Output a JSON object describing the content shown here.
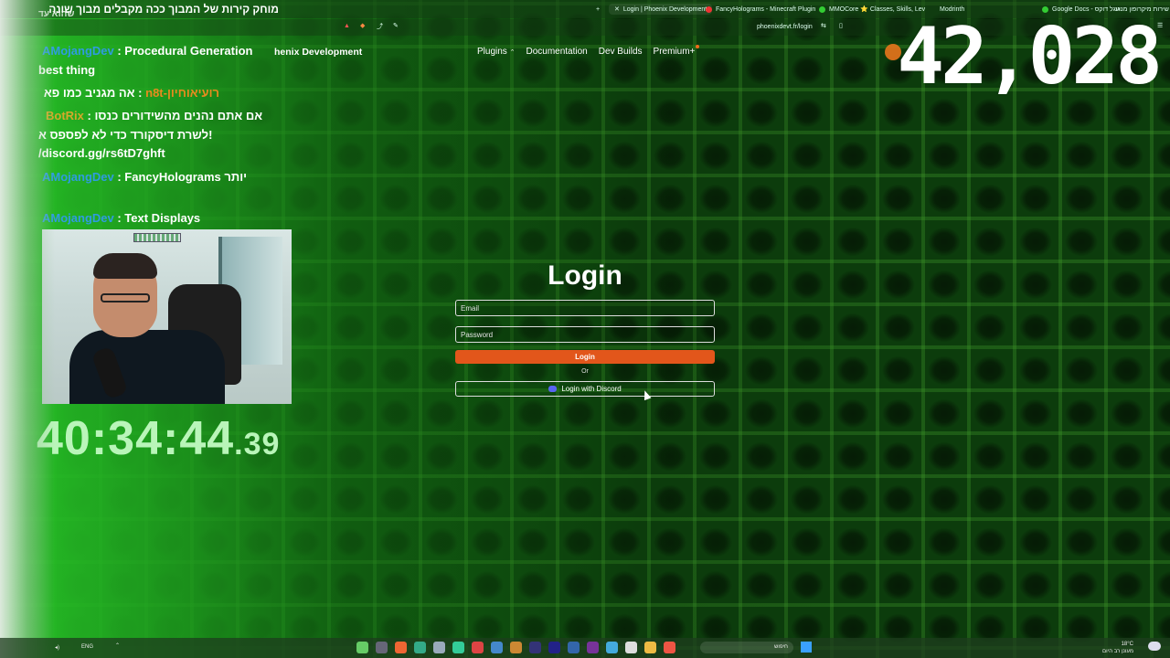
{
  "browser": {
    "tabs": [
      {
        "title": "Login | Phoenix Development",
        "active": true
      },
      {
        "title": "FancyHolograms - Minecraft Plugin"
      },
      {
        "title": "MMOCore ⭐ Classes, Skills, Lev"
      },
      {
        "title": "Modrinth"
      },
      {
        "title": "Google Docs - גוגל דוקס"
      },
      {
        "title": "שירות מיקרופון מנוע"
      }
    ],
    "url": "phoenixdevt.fr/login"
  },
  "site": {
    "brand": "henix Development",
    "nav": [
      "Plugins",
      "Documentation",
      "Dev Builds",
      "Premium+"
    ]
  },
  "login": {
    "title": "Login",
    "email_placeholder": "Email",
    "password_placeholder": "Password",
    "login_button": "Login",
    "or_label": "Or",
    "discord_button": "Login with Discord"
  },
  "stream": {
    "counter": "42,028",
    "timer_main": "40:34:44",
    "timer_ms": ".39",
    "pinned_title": "מוחק קירות של המבוך ככה מקבלים מבוך שונה",
    "pinned_sub": "שהוא עד",
    "chat": [
      {
        "name": "AMojangDev",
        "name_color": "blue",
        "text": ": Procedural Generation"
      },
      {
        "name": "",
        "text": "best thing"
      },
      {
        "name": "רועיאוחיון-n8t",
        "name_color": "orange",
        "text": ": אה מגניב כמו פא"
      },
      {
        "name": "BotRix",
        "name_color": "gold",
        "text": ": אם אתם נהנים מהשידורים כנסו"
      },
      {
        "name": "",
        "text": "לשרת דיסקורד כדי לא לפספס א!"
      },
      {
        "name": "",
        "text": "/discord.gg/rs6tD7ghft"
      },
      {
        "name": "AMojangDev",
        "name_color": "blue",
        "text": ": FancyHolograms יותר"
      },
      {
        "name": "AMojangDev",
        "name_color": "blue",
        "text": ": Text Displays"
      }
    ]
  },
  "taskbar": {
    "lang": "ENG",
    "search_placeholder": "חיפוש",
    "time": "18°C",
    "weather": "מעונן רב היום"
  }
}
